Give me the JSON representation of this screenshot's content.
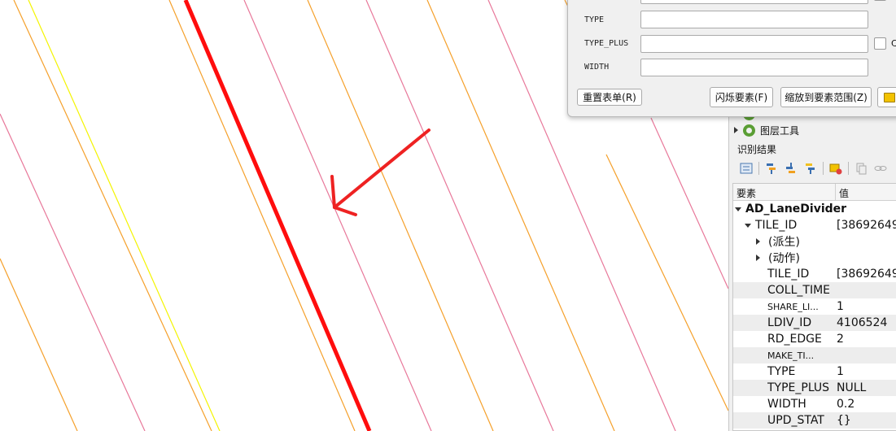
{
  "form": {
    "fields": [
      {
        "label": "TYPE",
        "value": ""
      },
      {
        "label": "TYPE_PLUS",
        "value": ""
      },
      {
        "label": "WIDTH",
        "value": ""
      }
    ],
    "checkbox_label_partial": "C",
    "buttons": {
      "reset": "重置表单(R)",
      "flash": "闪烁要素(F)",
      "zoom": "缩放到要素范围(Z)"
    }
  },
  "layers_panel": {
    "partial_item": "...",
    "layer_tools": "图层工具"
  },
  "identify": {
    "title": "识别结果",
    "col_feature": "要素",
    "col_value": "值",
    "layer_name": "AD_LaneDivider",
    "feature_id_label": "TILE_ID",
    "feature_id_value": "[38692649",
    "derived": "(派生)",
    "actions": "(动作)",
    "attributes": [
      {
        "key": "TILE_ID",
        "value": "[38692649"
      },
      {
        "key": "COLL_TIME",
        "value": ""
      },
      {
        "key": "SHARE_LI...",
        "value": "1"
      },
      {
        "key": "LDIV_ID",
        "value": "4106524"
      },
      {
        "key": "RD_EDGE",
        "value": "2"
      },
      {
        "key": "MAKE_TI...",
        "value": ""
      },
      {
        "key": "TYPE",
        "value": "1"
      },
      {
        "key": "TYPE_PLUS",
        "value": "NULL"
      },
      {
        "key": "WIDTH",
        "value": "0.2"
      },
      {
        "key": "UPD_STAT",
        "value": "{}"
      }
    ]
  },
  "map": {
    "colors": {
      "orange": "#f5a02a",
      "pink": "#e8789a",
      "yellow": "#f4f400",
      "highlight": "#ff0d0d"
    }
  }
}
